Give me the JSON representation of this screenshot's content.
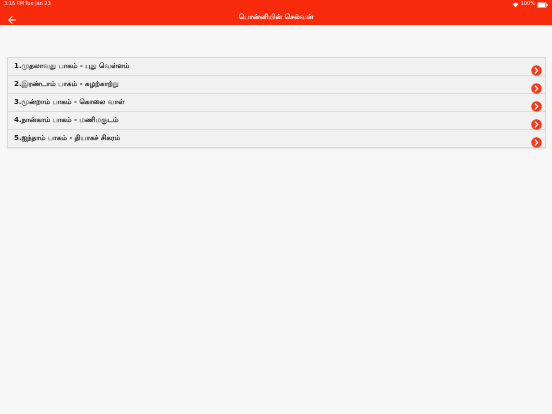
{
  "status_bar": {
    "time": "3:16 PM",
    "date": "Tue Jan 23",
    "battery": "100%"
  },
  "header": {
    "title": "பொன்னியின் செல்வன்",
    "back_icon": "arrow-left-icon"
  },
  "colors": {
    "brand": "#f72a0c",
    "background": "#f7f7f7",
    "row_icon": "#f5391a"
  },
  "chapters": [
    {
      "label": "1.முதலாவது பாகம் - புது வெள்ளம்"
    },
    {
      "label": "2.இரண்டாம் பாகம் - சுழற்காற்று"
    },
    {
      "label": "3.மூன்றாம் பாகம் - கொலை வாள்"
    },
    {
      "label": "4.நான்காம் பாகம் - மணிமகுடம்"
    },
    {
      "label": "5.ஐந்தாம் பாகம் - தியாகச் சிகரம்"
    }
  ],
  "row_icon": "chevron-right-circle-icon"
}
